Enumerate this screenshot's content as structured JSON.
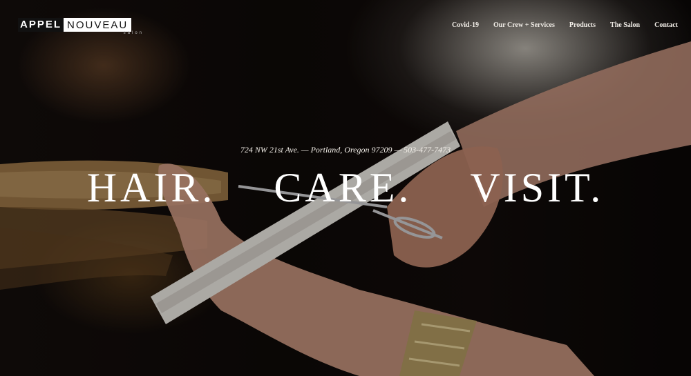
{
  "header": {
    "logo_primary": "APPEL",
    "logo_secondary": "NOUVEAU",
    "logo_sub": "salon",
    "nav": [
      {
        "label": "Covid-19"
      },
      {
        "label": "Our Crew + Services"
      },
      {
        "label": "Products"
      },
      {
        "label": "The Salon"
      },
      {
        "label": "Contact"
      }
    ]
  },
  "hero": {
    "address": "724 NW 21st Ave. — Portland, Oregon 97209 — 503-477-7473",
    "tagline": [
      "HAIR.",
      "CARE.",
      "VISIT."
    ]
  },
  "colors": {
    "text": "#ffffff",
    "background": "#0c0908"
  }
}
